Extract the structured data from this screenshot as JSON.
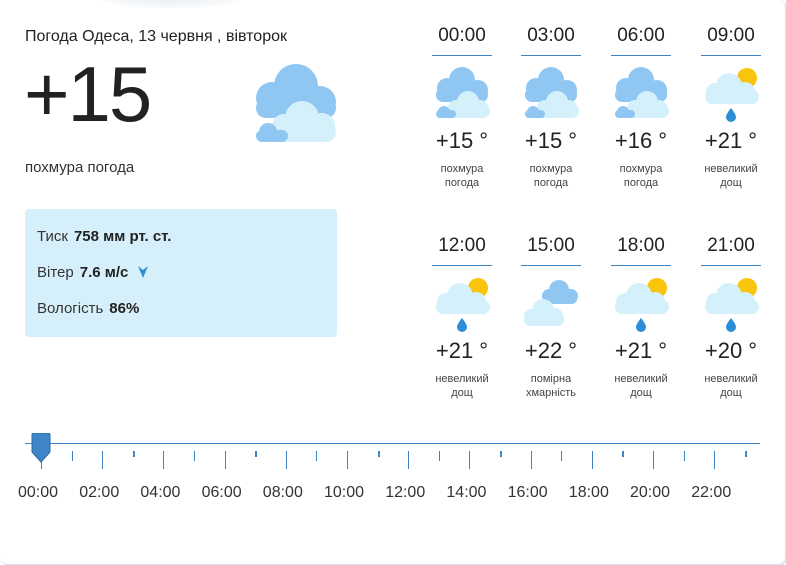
{
  "current": {
    "title": "Погода Одеса, 13 червня , вівторок",
    "temperature": "+15",
    "description": "похмура погода",
    "icon": "cloudy-icon"
  },
  "details": {
    "pressure_label": "Тиск",
    "pressure_value": "758 мм рт. ст.",
    "wind_label": "Вітер",
    "wind_value": "7.6 м/с",
    "wind_direction_icon": "wind-direction-arrow-icon",
    "humidity_label": "Вологість",
    "humidity_value": "86%"
  },
  "hourly": [
    {
      "time": "00:00",
      "temp": "+15 °",
      "desc": "похмура погода",
      "icon": "cloudy-icon"
    },
    {
      "time": "03:00",
      "temp": "+15 °",
      "desc": "похмура погода",
      "icon": "cloudy-icon"
    },
    {
      "time": "06:00",
      "temp": "+16 °",
      "desc": "похмура погода",
      "icon": "cloudy-icon"
    },
    {
      "time": "09:00",
      "temp": "+21 °",
      "desc": "невеликий дощ",
      "icon": "sun-cloud-rain-icon"
    },
    {
      "time": "12:00",
      "temp": "+21 °",
      "desc": "невеликий дощ",
      "icon": "sun-cloud-rain-icon"
    },
    {
      "time": "15:00",
      "temp": "+22 °",
      "desc": "помірна хмарність",
      "icon": "partly-cloudy-icon"
    },
    {
      "time": "18:00",
      "temp": "+21 °",
      "desc": "невеликий дощ",
      "icon": "sun-cloud-rain-icon"
    },
    {
      "time": "21:00",
      "temp": "+20 °",
      "desc": "невеликий дощ",
      "icon": "sun-cloud-rain-icon"
    }
  ],
  "timeline": {
    "labels": [
      "00:00",
      "02:00",
      "04:00",
      "06:00",
      "08:00",
      "10:00",
      "12:00",
      "14:00",
      "16:00",
      "18:00",
      "20:00",
      "22:00"
    ],
    "selected": "00:00",
    "slider_position_fraction": 0.0
  },
  "colors": {
    "accent": "#3e86c7",
    "info_bg": "#d6f0fb",
    "cloud_dark": "#8fc7f2",
    "cloud_light": "#d4f1fb",
    "sun": "#f9c40c",
    "rain": "#2c8fd6"
  }
}
